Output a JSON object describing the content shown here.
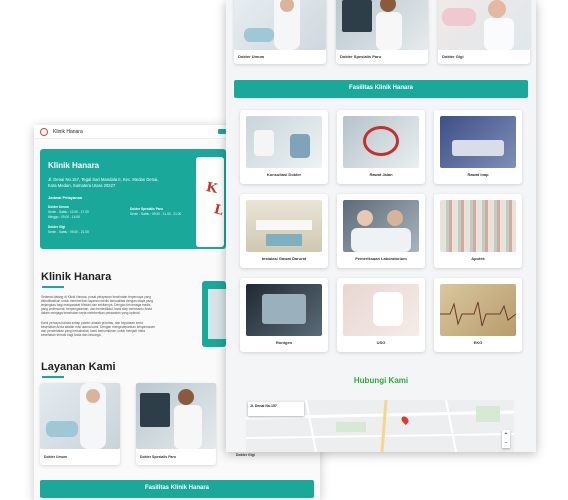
{
  "brand": {
    "name": "Klinik Hanara",
    "accent": "#1aa89a"
  },
  "hero": {
    "title": "Klinik Hanara",
    "address_line1": "Jl. Denai No.157, Tegal Sari Mandala II, Kec. Medan Denai,",
    "address_line2": "Kota Medan, Sumatera Utara 20227",
    "schedule_title": "Jadwal Pelayanan",
    "schedule": [
      {
        "name": "Dokter Umum",
        "l1": "Senin - Sabtu : 12.00 - 17.00",
        "l2": "Minggu : 09.00 - 14.00"
      },
      {
        "name": "Dokter Spesialis Paru",
        "l1": "Senin - Sabtu : 09.00 - 11.00 - 21.00",
        "l2": ""
      },
      {
        "name": "Dokter Gigi",
        "l1": "Senin - Sabtu : 09.00 - 21.00",
        "l2": ""
      }
    ]
  },
  "about": {
    "title": "Klinik Hanara",
    "p1": [
      "Selamat datang di Klinik Hanara, pusat pelayanan kesehatan terpercaya yang",
      "didedikasikan untuk memberikan layanan medis berkualitas dengan biaya yang",
      "terjangkau bagi masyarakat Medan dan sekitarnya. Dengan tim tenaga medis",
      "yang profesional, berpengalaman, dan berdedikasi, kami siap membantu Anda",
      "dalam menjaga kesehatan serta memberikan perawatan yang optimal."
    ],
    "p2": [
      "Kami percaya bahwa setiap pasien adalah prioritas, dan kepuasan serta",
      "kesehatan Anda adalah misi utama kami. Dengan mengedepankan kenyamanan",
      "dan pendekatan yang bersahabat, kami berkomitmen untuk menjadi mitra",
      "kesehatan terbaik bagi Anda dan keluarga."
    ]
  },
  "services": {
    "title": "Layanan Kami",
    "items": [
      {
        "label": "Dokter Umum"
      },
      {
        "label": "Dokter Spesialis Paru"
      },
      {
        "label": "Dokter Gigi"
      }
    ]
  },
  "facilities": {
    "title": "Fasilitas Klinik Hanara",
    "items": [
      {
        "label": "Konsultasi Dokter"
      },
      {
        "label": "Rawat Jalan"
      },
      {
        "label": "Rawat Inap"
      },
      {
        "label": "Instalasi Gawat Darurat"
      },
      {
        "label": "Pemeriksaan Laboratorium"
      },
      {
        "label": "Apotek"
      },
      {
        "label": "Rontgen"
      },
      {
        "label": "USG"
      },
      {
        "label": "EKG"
      }
    ]
  },
  "contact": {
    "title": "Hubungi Kami",
    "map_label": "Jl. Denai No.157"
  }
}
